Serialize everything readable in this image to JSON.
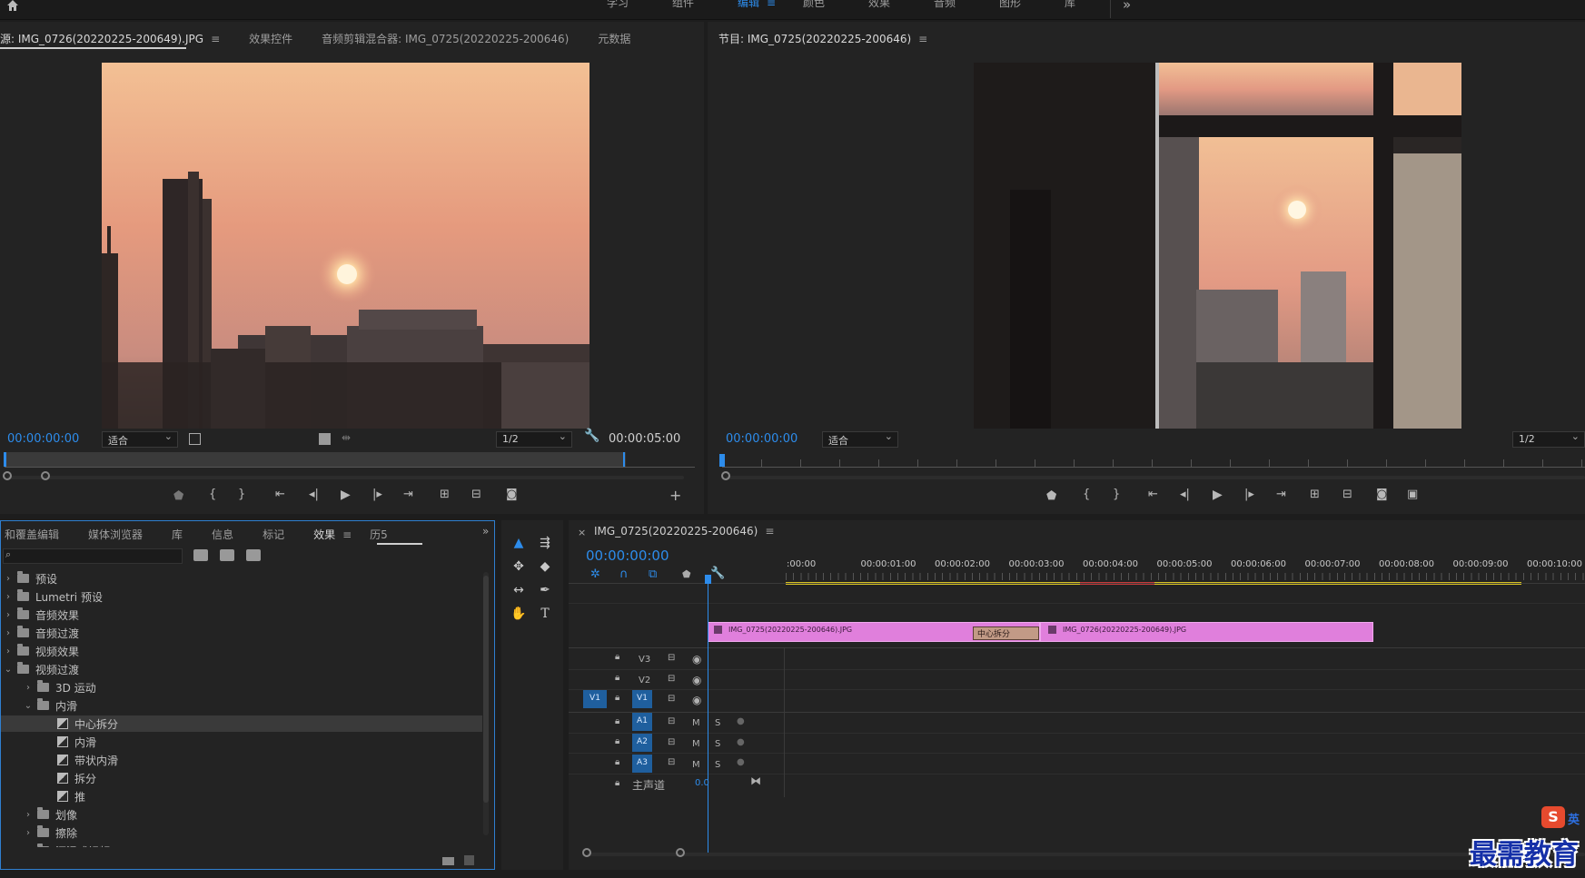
{
  "workspace": {
    "tabs": [
      {
        "label": "学习"
      },
      {
        "label": "组件"
      },
      {
        "label": "编辑",
        "active": true
      },
      {
        "label": "颜色"
      },
      {
        "label": "效果"
      },
      {
        "label": "音频"
      },
      {
        "label": "图形"
      },
      {
        "label": "库"
      }
    ],
    "more": "»"
  },
  "source_panel": {
    "tabs": [
      "源: IMG_0726(20220225-200649).JPG",
      "效果控件",
      "音频剪辑混合器: IMG_0725(20220225-200646)",
      "元数据"
    ],
    "timecode_in": "00:00:00:00",
    "zoom": "适合",
    "resolution": "1/2",
    "timecode_out": "00:00:05:00"
  },
  "program_panel": {
    "title": "节目: IMG_0725(20220225-200646)",
    "timecode": "00:00:00:00",
    "zoom": "适合",
    "resolution": "1/2"
  },
  "effects_panel": {
    "tabs": [
      "和覆盖编辑",
      "媒体浏览器",
      "库",
      "信息",
      "标记",
      "效果",
      "历5"
    ],
    "active_tab": "效果",
    "tree": [
      {
        "label": "预设",
        "type": "folder",
        "level": 0
      },
      {
        "label": "Lumetri 预设",
        "type": "folder",
        "level": 0
      },
      {
        "label": "音频效果",
        "type": "folder",
        "level": 0
      },
      {
        "label": "音频过渡",
        "type": "folder",
        "level": 0
      },
      {
        "label": "视频效果",
        "type": "folder",
        "level": 0
      },
      {
        "label": "视频过渡",
        "type": "folder",
        "level": 0,
        "open": true
      },
      {
        "label": "3D 运动",
        "type": "folder",
        "level": 1
      },
      {
        "label": "内滑",
        "type": "folder",
        "level": 1,
        "open": true
      },
      {
        "label": "中心拆分",
        "type": "effect",
        "level": 2,
        "selected": true
      },
      {
        "label": "内滑",
        "type": "effect",
        "level": 2
      },
      {
        "label": "带状内滑",
        "type": "effect",
        "level": 2
      },
      {
        "label": "拆分",
        "type": "effect",
        "level": 2
      },
      {
        "label": "推",
        "type": "effect",
        "level": 2
      },
      {
        "label": "划像",
        "type": "folder",
        "level": 1
      },
      {
        "label": "擦除",
        "type": "folder",
        "level": 1
      },
      {
        "label": "沉浸式视频",
        "type": "folder",
        "level": 1
      }
    ]
  },
  "timeline": {
    "sequence": "IMG_0725(20220225-200646)",
    "timecode": "00:00:00:00",
    "ruler": [
      ":00:00",
      "00:00:01:00",
      "00:00:02:00",
      "00:00:03:00",
      "00:00:04:00",
      "00:00:05:00",
      "00:00:06:00",
      "00:00:07:00",
      "00:00:08:00",
      "00:00:09:00",
      "00:00:10:00"
    ],
    "tracks": {
      "video": [
        "V3",
        "V2",
        "V1"
      ],
      "audio": [
        "A1",
        "A2",
        "A3"
      ],
      "source_patch": "V1",
      "mute": "M",
      "solo": "S",
      "master_label": "主声道",
      "master_value": "0.0"
    },
    "clips": [
      {
        "name": "IMG_0725(20220225-200646).JPG"
      },
      {
        "name": "IMG_0726(20220225-200649).JPG"
      }
    ],
    "transition": "中心拆分"
  },
  "watermark": "最需教育",
  "ime": {
    "logo": "S",
    "mode": "英"
  },
  "colors": {
    "accent": "#2d8ceb",
    "clip": "#e07fdc",
    "panel": "#232323",
    "frame_border": "#2f7fd0"
  }
}
